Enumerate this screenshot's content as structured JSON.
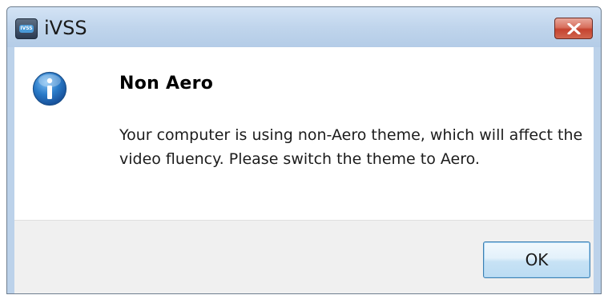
{
  "window": {
    "title": "iVSS",
    "app_icon": "ivss-app-icon",
    "app_icon_text": "IVSS",
    "close_icon": "close-icon"
  },
  "dialog": {
    "icon": "info-icon",
    "heading": "Non Aero",
    "message": "Your computer is using non-Aero theme, which will affect the video fluency. Please switch the theme to Aero.",
    "ok_label": "OK"
  },
  "colors": {
    "titlebar": "#c0d5ec",
    "close_button": "#c5432f",
    "footer": "#f0f0f0",
    "info_icon": "#2a7bc8",
    "ok_border": "#3c7fb1"
  }
}
